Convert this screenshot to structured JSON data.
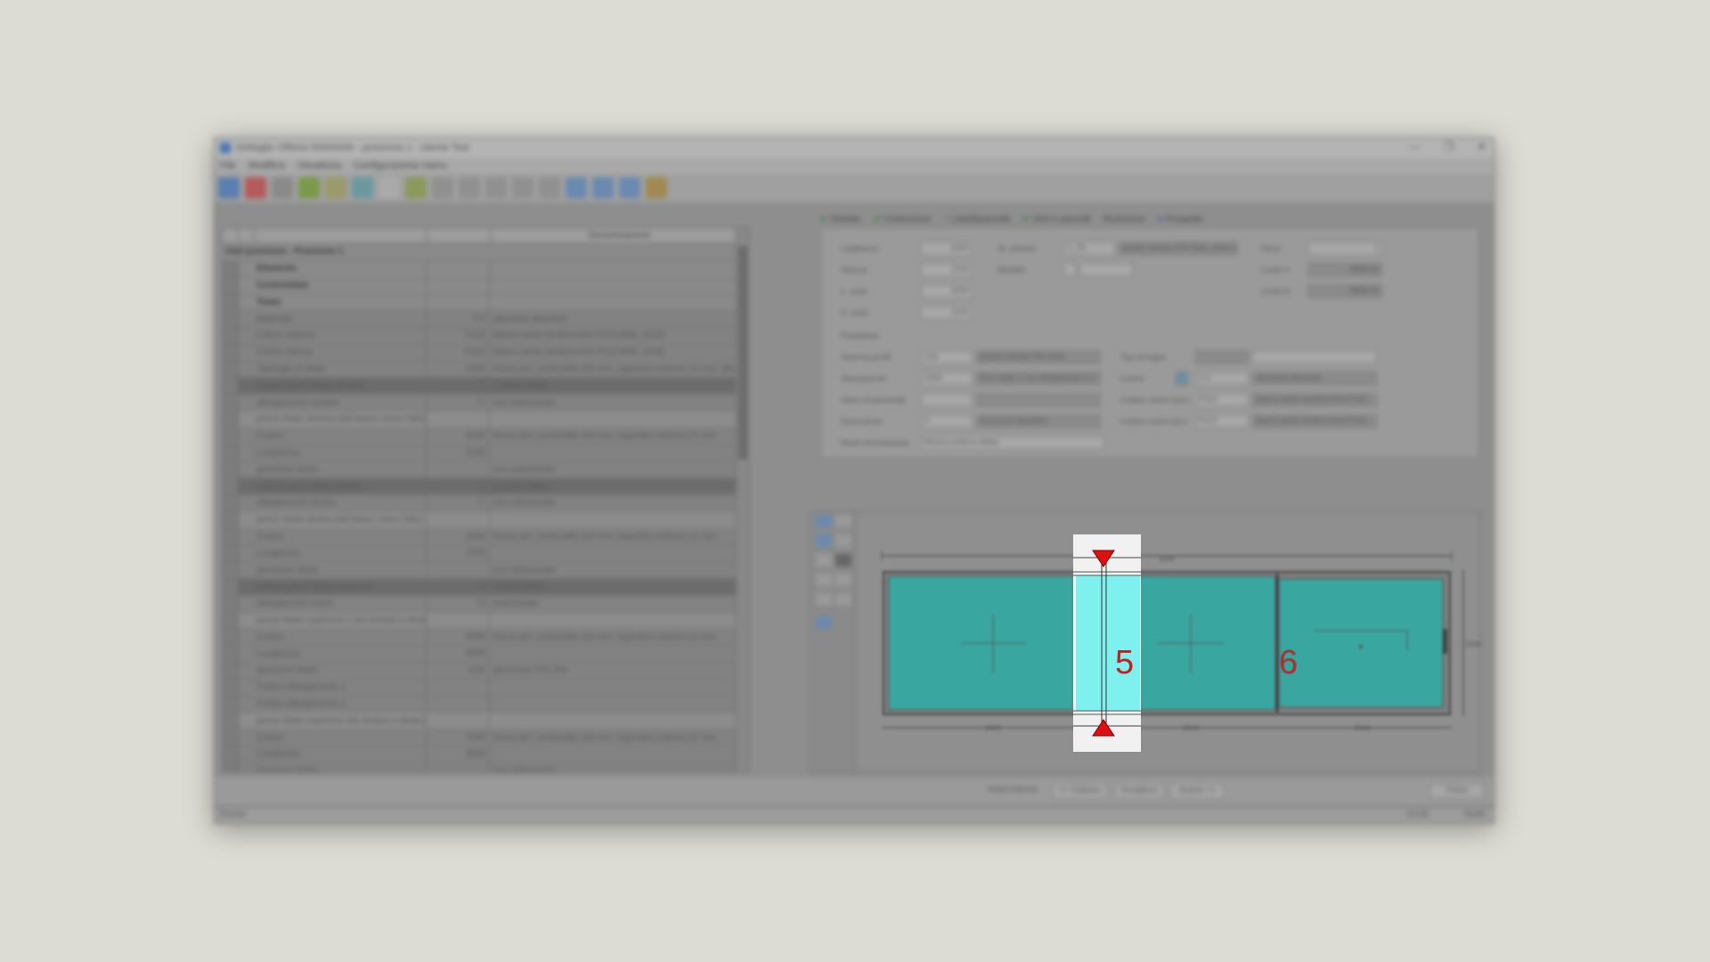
{
  "window": {
    "title": "Dettaglio Offerta 00000006 - posizione 1 - cliente Test",
    "controls": {
      "minimize": "—",
      "restore": "❐",
      "close": "✕"
    }
  },
  "menu": [
    "File",
    "Modifica",
    "Visualizza",
    "Configurazione menu"
  ],
  "left_grid": {
    "headers": [
      "",
      "",
      "",
      "",
      "Denominazione"
    ],
    "section_title": "Dati posizione - Posizione 1",
    "rows": [
      {
        "label": "Elemento",
        "code": "",
        "value": "",
        "type": "group"
      },
      {
        "label": "Controtelaio",
        "code": "",
        "value": "",
        "type": "group"
      },
      {
        "label": "Telaio",
        "code": "",
        "value": "",
        "type": "group"
      },
      {
        "label": "Materiale",
        "code": "2-2",
        "value": "alluminio-alluminio",
        "type": "normal"
      },
      {
        "label": "Colore esterno",
        "code": "P113",
        "value": "bianco perla struttura fine P113 (RAL 1013)",
        "type": "normal"
      },
      {
        "label": "Colore interno",
        "code": "P113",
        "value": "bianco perla struttura fine P113 (RAL 1013)",
        "type": "normal"
      },
      {
        "label": "Tipologia di telaio",
        "code": "4266",
        "value": "forma ad L profondità 160 mm, ingombro esterno 21 mm, allum",
        "type": "normal"
      },
      {
        "label": "numero pezzi telaio sinistra",
        "code": "1",
        "value": "1 pezzo telaio",
        "type": "hl"
      },
      {
        "label": "allargamento sinistra",
        "code": "☐",
        "value": "non selezionato",
        "type": "normal"
      },
      {
        "label": "pezzo telaio sinistra (dal basso verso l'alto)",
        "code": "",
        "value": "",
        "type": "light"
      },
      {
        "label": "Codice",
        "code": "4266",
        "value": "forma ad L profondità 160 mm, ingombro esterno 21 mm",
        "type": "normal"
      },
      {
        "label": "Lunghezza",
        "code": "2100",
        "value": "",
        "type": "normal"
      },
      {
        "label": "giunzione telaio",
        "code": "",
        "value": "non selezionato",
        "type": "normal"
      },
      {
        "label": "numero pezzi telaio destra",
        "code": "1",
        "value": "1 pezzo telaio",
        "type": "hl"
      },
      {
        "label": "allargamento destra",
        "code": "☐",
        "value": "non selezionato",
        "type": "normal"
      },
      {
        "label": "pezzo telaio destra (dal basso verso l'alto)",
        "code": "",
        "value": "",
        "type": "light"
      },
      {
        "label": "Codice",
        "code": "4266",
        "value": "forma ad L profondità 160 mm, ingombro esterno 21 mm",
        "type": "normal"
      },
      {
        "label": "Lunghezza",
        "code": "2100",
        "value": "",
        "type": "normal"
      },
      {
        "label": "giunzione telaio",
        "code": "",
        "value": "non selezionato",
        "type": "normal"
      },
      {
        "label": "numero pezzi telaio superiore",
        "code": "2",
        "value": "2 pezzi telaio",
        "type": "hl"
      },
      {
        "label": "allargamento sopra",
        "code": "☑",
        "value": "selezionato",
        "type": "normal"
      },
      {
        "label": "pezzo telaio superiore 1 (da sinistra a destra)",
        "code": "",
        "value": "",
        "type": "light"
      },
      {
        "label": "Codice",
        "code": "4266",
        "value": "forma ad L profondità 160 mm, ingombro esterno 21 mm",
        "type": "normal"
      },
      {
        "label": "Lunghezza",
        "code": "3200",
        "value": "",
        "type": "normal"
      },
      {
        "label": "giunzione telaio",
        "code": "VS1",
        "value": "giunzione VS1 fine",
        "type": "normal"
      },
      {
        "label": "Codice allargamento 1",
        "code": "",
        "value": "",
        "type": "normal"
      },
      {
        "label": "Codice allargamento 2",
        "code": "",
        "value": "",
        "type": "normal"
      },
      {
        "label": "pezzo telaio superiore (da sinistra a destra)",
        "code": "",
        "value": "",
        "type": "light"
      },
      {
        "label": "Codice",
        "code": "4266",
        "value": "forma ad L profondità 160 mm, ingombro esterno 21 mm",
        "type": "normal"
      },
      {
        "label": "Lunghezza",
        "code": "3000",
        "value": "",
        "type": "normal"
      },
      {
        "label": "giunzione telaio",
        "code": "",
        "value": "non selezionato",
        "type": "normal"
      }
    ]
  },
  "tabs": [
    {
      "label": "Globale",
      "check": true
    },
    {
      "label": "Costruzione",
      "check": true
    },
    {
      "label": "Listelli/pannelli",
      "check": false
    },
    {
      "label": "Vetri e pannelli",
      "check": true
    },
    {
      "label": "Restrizioni",
      "check": false
    },
    {
      "label": "Prospetto",
      "check": false
    }
  ],
  "form": {
    "larghezza_label": "Larghezza",
    "larghezza": "6200",
    "altezza_label": "Altezza",
    "altezza": "2100",
    "lcostr_label": "L. costr.",
    "lcostr": "6200",
    "acostr_label": "A. costr.",
    "acostr": "2100",
    "nr_articolo_label": "Nr. articolo",
    "nr_articolo": "V_00",
    "articolo_desc": "parete vetrata FIN-Vista, porta s",
    "modello_label": "Modello",
    "pezzi_label": "Pezzi",
    "pezzi": "1",
    "lordo_v_label": "Lordo-V",
    "lordo_v": "9868.20",
    "lordo_n_label": "Lordo-N",
    "lordo_n": "9868.20",
    "predefinito_label": "Predefinito",
    "sistema_label": "Sistema profili",
    "sistema_code": "136",
    "sistema_desc": "parete vetrata FIN-Vista",
    "vetro_label": "Vetro/pannel",
    "vetro_code": "2303",
    "vetro_desc": "Plus-Valor 2 con Multiprotect a 4",
    "ornamentale_label": "Vetro ornamentale",
    "esecuzione_label": "Esecuzione",
    "esecuzione_code": "0",
    "esecuzione_desc": "sicurezza standard",
    "immissione_label": "Modo d'immissione",
    "immissione": "Misura esterno telaio",
    "tipo_foglio_label": "Tipo di foglio",
    "colore_label": "Colore",
    "colore_code": "2-2",
    "colore_desc": "alluminio-alluminio",
    "codice_est_label": "Codice colore (est.)",
    "codice_est": "P113",
    "codice_est_desc": "bianco perla struttura fine P113",
    "codice_int_label": "Codice colore (int.)",
    "codice_int": "P113",
    "codice_int_desc": "bianco perla struttura fine P113"
  },
  "drawing": {
    "top_dim": "3200",
    "bottom_dims": [
      "2600",
      "2600",
      "2000"
    ],
    "side_dim": "2100",
    "pane_color": "#3aa6a0",
    "highlight_color": "#7ef0ee",
    "marker_color": "#e01010",
    "labels": [
      "5",
      "6"
    ]
  },
  "bottom_buttons": {
    "vista": "Vista interna",
    "indietro": "<< Indietro",
    "scegliere": "Scegliere",
    "avanti": "Avanti >>",
    "finire": "Finire"
  },
  "status": {
    "left": "Pronto",
    "time": "10:06",
    "mode": "NUM"
  }
}
